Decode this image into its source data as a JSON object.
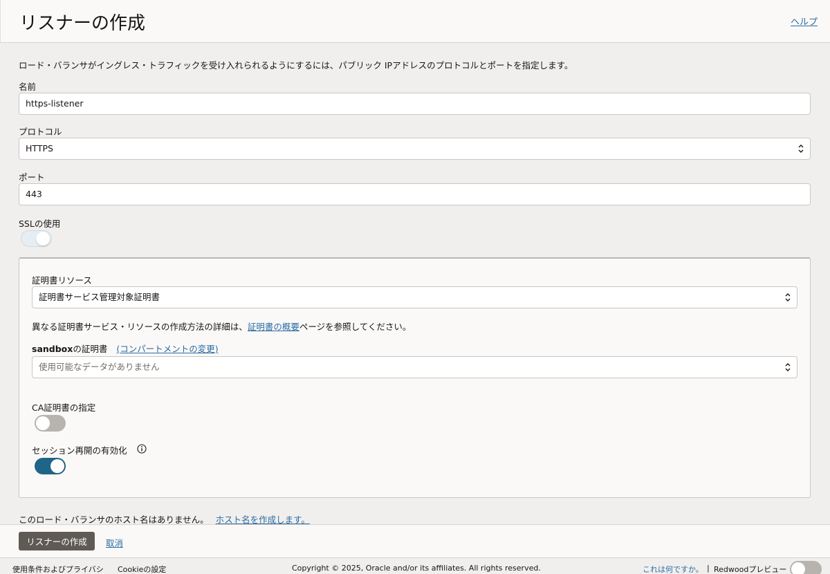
{
  "header": {
    "title": "リスナーの作成",
    "help_link": "ヘルプ"
  },
  "form": {
    "intro": "ロード・バランサがイングレス・トラフィックを受け入れられるようにするには、パブリック IPアドレスのプロトコルとポートを指定します。",
    "name_label": "名前",
    "name_value": "https-listener",
    "protocol_label": "プロトコル",
    "protocol_value": "HTTPS",
    "port_label": "ポート",
    "port_value": "443",
    "ssl_label": "SSLの使用",
    "ssl_enabled": true
  },
  "ssl_panel": {
    "cert_resource_label": "証明書リソース",
    "cert_resource_value": "証明書サービス管理対象証明書",
    "help_text_prefix": "異なる証明書サービス・リソースの作成方法の詳細は、",
    "help_text_link": "証明書の概要",
    "help_text_suffix": "ページを参照してください。",
    "cert_label_bold": "sandbox",
    "cert_label_rest": "の証明書",
    "change_compartment_link": "(コンパートメントの変更)",
    "cert_placeholder": "使用可能なデータがありません",
    "ca_cert_label": "CA証明書の指定",
    "ca_cert_enabled": false,
    "session_resume_label": "セッション再開の有効化",
    "session_resume_enabled": true
  },
  "hostname": {
    "text": "このロード・バランサのホスト名はありません。",
    "link": "ホスト名を作成します。"
  },
  "actions": {
    "create_button": "リスナーの作成",
    "cancel_link": "取消"
  },
  "footer": {
    "terms": "使用条件およびプライバシ",
    "cookie": "Cookieの設定",
    "copyright": "Copyright © 2025, Oracle and/or its affiliates. All rights reserved.",
    "what_is_this": "これは何ですか。",
    "separator": "|",
    "redwood_preview": "Redwoodプレビュー",
    "redwood_enabled": false
  },
  "colors": {
    "accent": "#1f6587",
    "link": "#2b6ca3",
    "primary_button": "#5f5a55",
    "page_bg": "#f1efed",
    "panel_bg": "#fbf9f8"
  }
}
